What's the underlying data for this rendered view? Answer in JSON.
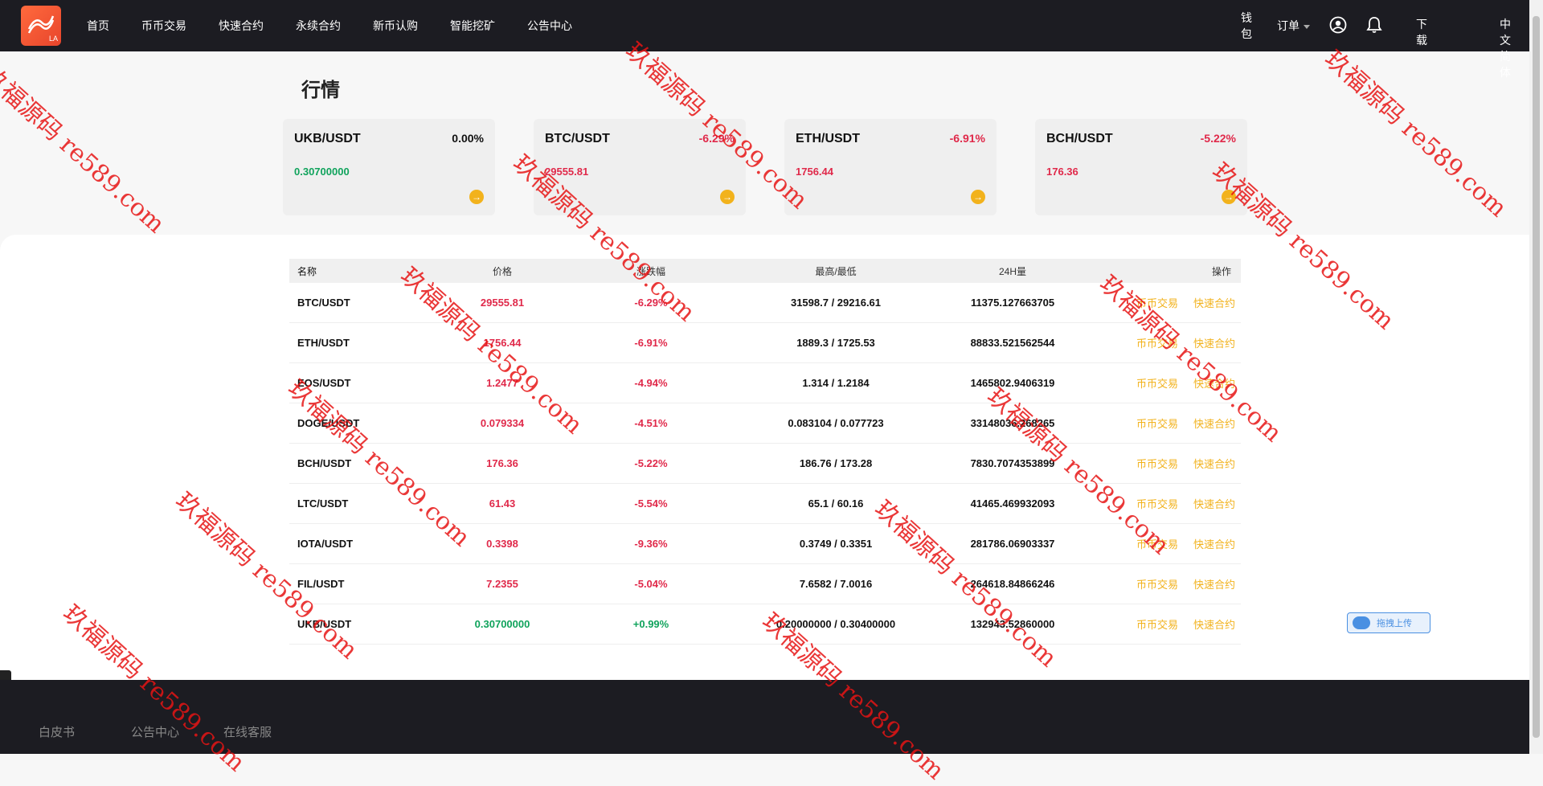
{
  "nav": {
    "logo_text": "LA",
    "items": [
      "首页",
      "币币交易",
      "快速合约",
      "永续合约",
      "新币认购",
      "智能挖矿",
      "公告中心"
    ],
    "right": {
      "wallet": "钱包",
      "orders": "订单",
      "download": "下载",
      "language": "中文简体"
    }
  },
  "page": {
    "title": "行情"
  },
  "cards": [
    {
      "pair": "UKB/USDT",
      "change": "0.00%",
      "price": "0.30700000",
      "trend": "flat"
    },
    {
      "pair": "BTC/USDT",
      "change": "-6.29%",
      "price": "29555.81",
      "trend": "down"
    },
    {
      "pair": "ETH/USDT",
      "change": "-6.91%",
      "price": "1756.44",
      "trend": "down"
    },
    {
      "pair": "BCH/USDT",
      "change": "-5.22%",
      "price": "176.36",
      "trend": "down"
    }
  ],
  "table": {
    "headers": {
      "name": "名称",
      "price": "价格",
      "change": "涨跌幅",
      "highlow": "最高/最低",
      "volume": "24H量",
      "action": "操作"
    },
    "rows": [
      {
        "name": "BTC/USDT",
        "price": "29555.81",
        "change": "-6.29%",
        "highlow": "31598.7 / 29216.61",
        "volume": "11375.127663705",
        "op1": "币币交易",
        "op2": "快速合约"
      },
      {
        "name": "ETH/USDT",
        "price": "1756.44",
        "change": "-6.91%",
        "highlow": "1889.3 / 1725.53",
        "volume": "88833.521562544",
        "op1": "币币交易",
        "op2": "快速合约"
      },
      {
        "name": "EOS/USDT",
        "price": "1.2477",
        "change": "-4.94%",
        "highlow": "1.314 / 1.2184",
        "volume": "1465802.9406319",
        "op1": "币币交易",
        "op2": "快速合约"
      },
      {
        "name": "DOGE/USDT",
        "price": "0.079334",
        "change": "-4.51%",
        "highlow": "0.083104 / 0.077723",
        "volume": "33148036.268265",
        "op1": "币币交易",
        "op2": "快速合约"
      },
      {
        "name": "BCH/USDT",
        "price": "176.36",
        "change": "-5.22%",
        "highlow": "186.76 / 173.28",
        "volume": "7830.7074353899",
        "op1": "币币交易",
        "op2": "快速合约"
      },
      {
        "name": "LTC/USDT",
        "price": "61.43",
        "change": "-5.54%",
        "highlow": "65.1 / 60.16",
        "volume": "41465.469932093",
        "op1": "币币交易",
        "op2": "快速合约"
      },
      {
        "name": "IOTA/USDT",
        "price": "0.3398",
        "change": "-9.36%",
        "highlow": "0.3749 / 0.3351",
        "volume": "281786.06903337",
        "op1": "币币交易",
        "op2": "快速合约"
      },
      {
        "name": "FIL/USDT",
        "price": "7.2355",
        "change": "-5.04%",
        "highlow": "7.6582 / 7.0016",
        "volume": "264618.84866246",
        "op1": "币币交易",
        "op2": "快速合约"
      },
      {
        "name": "UKB/USDT",
        "price": "0.30700000",
        "change": "+0.99%",
        "highlow": "0.20000000 / 0.30400000",
        "volume": "132943.52860000",
        "op1": "币币交易",
        "op2": "快速合约"
      }
    ]
  },
  "upload_widget": {
    "label": "拖拽上传"
  },
  "footer": {
    "links": [
      "白皮书",
      "公告中心",
      "在线客服"
    ]
  },
  "watermark": {
    "text": "玖福源码 re589.com"
  },
  "colors": {
    "up": "#10a35c",
    "down": "#e0294a",
    "accent": "#f2b21c",
    "topbar": "#1c1c22"
  }
}
